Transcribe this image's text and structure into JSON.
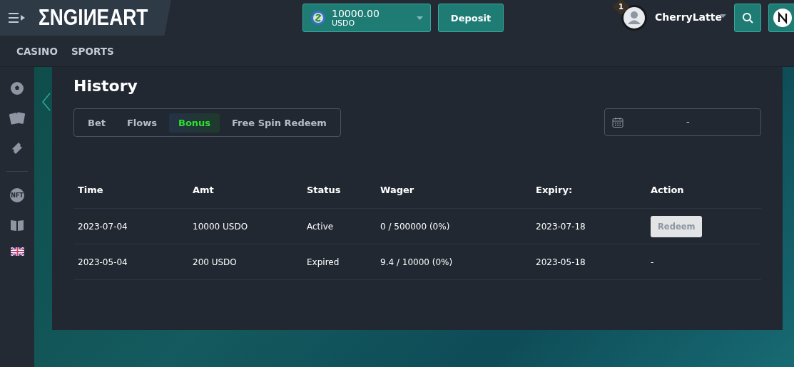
{
  "header": {
    "logo": "ΣNGIИEART",
    "balance": {
      "amount": "10000.00",
      "currency": "USDO"
    },
    "deposit": "Deposit",
    "notifications": "1",
    "username": "CherryLatte"
  },
  "nav": [
    {
      "label": "CASINO"
    },
    {
      "label": "SPORTS"
    }
  ],
  "sidebar": [
    {
      "kind": "ball"
    },
    {
      "kind": "cards"
    },
    {
      "kind": "ticket"
    },
    {
      "kind": "divider"
    },
    {
      "kind": "nft",
      "label": "NFT"
    },
    {
      "kind": "book"
    },
    {
      "kind": "flag"
    }
  ],
  "title": "History",
  "tabs": [
    {
      "label": "Bet",
      "selected": false
    },
    {
      "label": "Flows",
      "selected": false
    },
    {
      "label": "Bonus",
      "selected": true
    },
    {
      "label": "Free Spin Redeem",
      "selected": false
    }
  ],
  "date_range": {
    "separator": "-"
  },
  "table": {
    "columns": [
      "Time",
      "Amt",
      "Status",
      "Wager",
      "Expiry:",
      "Action"
    ],
    "rows": [
      {
        "time": "2023-07-04",
        "amount": "10000 USDO",
        "status": "Active",
        "wager": "0 / 500000 (0%)",
        "expiry": "2023-07-18",
        "action": {
          "kind": "button",
          "label": "Redeem",
          "disabled": true
        }
      },
      {
        "time": "2023-05-04",
        "amount": "200 USDO",
        "status": "Expired",
        "wager": "9.4 / 10000 (0%)",
        "expiry": "2023-05-18",
        "action": {
          "kind": "text",
          "label": "-"
        }
      }
    ]
  }
}
